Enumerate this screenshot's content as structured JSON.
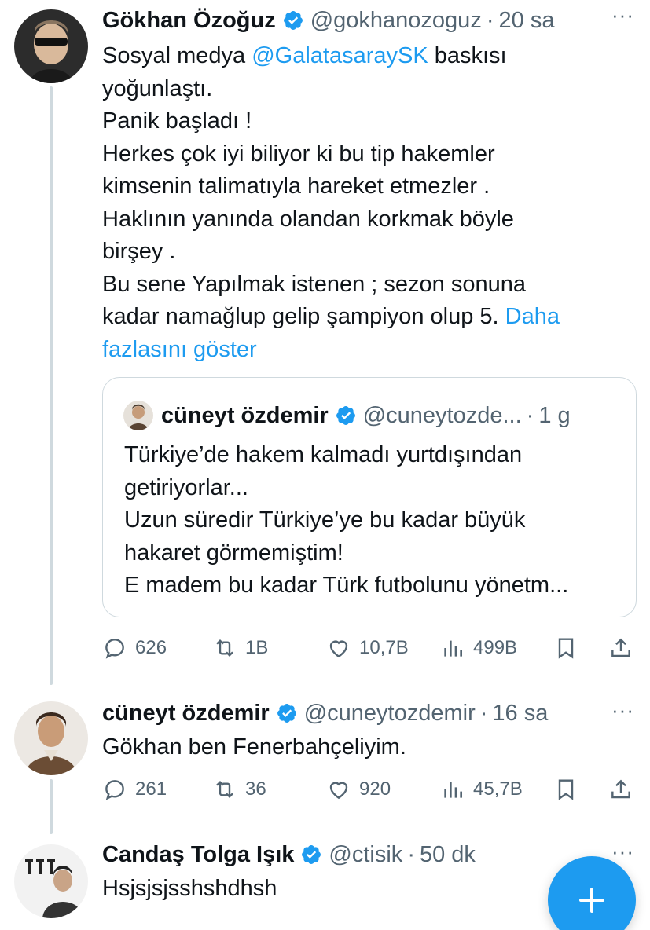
{
  "tweets": [
    {
      "name": "Gökhan Özoğuz",
      "handle": "@gokhanozoguz",
      "time": "20 sa",
      "text_lines": {
        "l1a": "Sosyal medya ",
        "l1mention": "@GalatasaraySK",
        "l1b": " baskısı",
        "l2": "yoğunlaştı.",
        "l3": "Panik başladı !",
        "l4": "Herkes çok iyi biliyor ki bu tip hakemler",
        "l5": "kimsenin talimatıyla hareket etmezler .",
        "l6": "Haklının yanında olandan korkmak böyle",
        "l7": "birşey .",
        "l8": "Bu sene Yapılmak istenen ;  sezon sonuna",
        "l9": "kadar namağlup gelip şampiyon olup 5. ",
        "l9more": "Daha",
        "l10more": "fazlasını göster"
      },
      "quote": {
        "name": "cüneyt özdemir",
        "handle": "@cuneytozde...",
        "time": "1 g",
        "lines": [
          "Türkiye’de hakem kalmadı yurtdışından",
          "getiriyorlar...",
          "Uzun süredir Türkiye’ye bu kadar büyük",
          "hakaret görmemiştim!",
          "E madem bu kadar Türk futbolunu yönetm..."
        ]
      },
      "stats": {
        "replies": "626",
        "retweets": "1B",
        "likes": "10,7B",
        "views": "499B"
      }
    },
    {
      "name": "cüneyt özdemir",
      "handle": "@cuneytozdemir",
      "time": "16 sa",
      "text": "Gökhan ben Fenerbahçeliyim.",
      "stats": {
        "replies": "261",
        "retweets": "36",
        "likes": "920",
        "views": "45,7B"
      }
    },
    {
      "name": "Candaş Tolga Işık",
      "handle": "@ctisik",
      "time": "50 dk",
      "text": "Hsjsjsjsshshdhsh"
    }
  ],
  "icons": {
    "verified": "verified-badge-icon",
    "reply": "reply-icon",
    "retweet": "retweet-icon",
    "like": "like-icon",
    "views": "views-icon",
    "bookmark": "bookmark-icon",
    "share": "share-icon",
    "more": "more-icon",
    "compose": "compose-plus-icon"
  },
  "colors": {
    "accent": "#1d9bf0",
    "text": "#0f1419",
    "muted": "#536471",
    "border": "#cfd9de"
  }
}
